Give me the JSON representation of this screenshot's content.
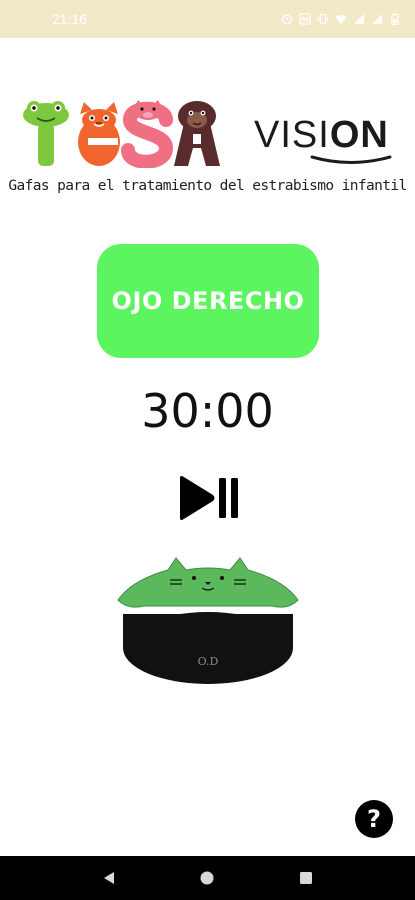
{
  "status_bar": {
    "time": "21:16",
    "icons": [
      "alarm-icon",
      "nfc-icon",
      "vibrate-icon",
      "wifi-icon",
      "signal-icon",
      "signal-icon",
      "battery-icon"
    ]
  },
  "brand": {
    "logo_letters": "TESA",
    "name_prefix": "VISI",
    "name_suffix": "ON",
    "tagline": "Gafas para el tratamiento del estrabismo infantil"
  },
  "eye_button": {
    "label": "OJO DERECHO",
    "color": "#5cf55f"
  },
  "timer": {
    "value": "30:00"
  },
  "controls": {
    "play_pause_icon": "play-pause-icon"
  },
  "goggles": {
    "label": "O.D",
    "frame_color": "#5cb85c",
    "lens_color": "#111111"
  },
  "help": {
    "label": "?"
  },
  "nav": {
    "items": [
      "back-icon",
      "home-icon",
      "recents-icon"
    ]
  }
}
